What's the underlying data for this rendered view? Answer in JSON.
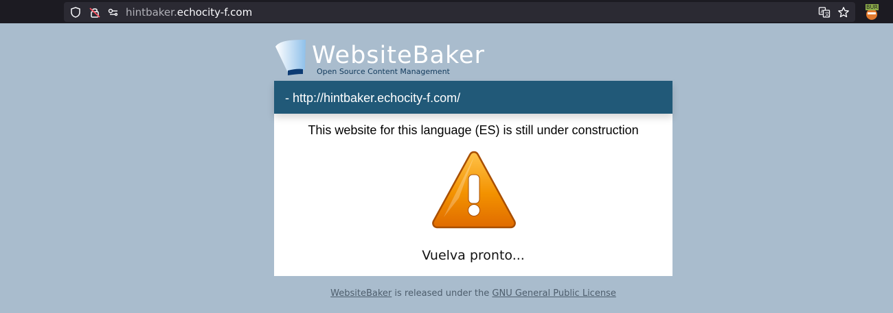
{
  "browser": {
    "url_host_prefix": "hintbaker.",
    "url_domain": "echocity-f.com",
    "extension_badge": "BUR"
  },
  "logo": {
    "word": "WebsiteBaker",
    "tagline": "Open Source Content Management"
  },
  "card": {
    "header": "- http://hintbaker.echocity-f.com/",
    "message": "This website for this language (ES) is still under construction",
    "icon": "warning-triangle-icon",
    "footer_text": "Vuelva pronto..."
  },
  "footer": {
    "link1": "WebsiteBaker",
    "middle": " is released under the ",
    "link2": "GNU General Public License"
  },
  "colors": {
    "background": "#a9bccd",
    "header_bar": "#215978",
    "warning_orange": "#f08a00"
  }
}
